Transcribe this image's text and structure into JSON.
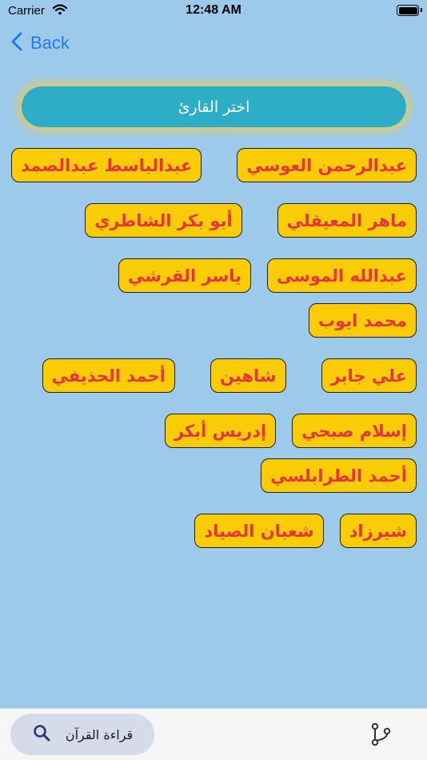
{
  "status_bar": {
    "carrier": "Carrier",
    "time": "12:48 AM"
  },
  "nav": {
    "back_label": "Back",
    "accent_color": "#1d7cf2"
  },
  "title": "اختر القارئ",
  "reciters": [
    "عبدالرحمن العوسي",
    "عبدالباسط عبدالصمد",
    "ماهر المعيقلي",
    "أبو بكر الشاطري",
    "عبدالله الموسى",
    "ياسر القرشي",
    "محمد ايوب",
    "علي جابر",
    "شاهين",
    "أحمد الحذيفي",
    "إسلام صبحي",
    "إدريس أبكر",
    "أحمد الطرابلسي",
    "شيرزاد",
    "شعبان الصياد"
  ],
  "tab_bar": {
    "tabs": [
      {
        "label": "قراءة القرآن",
        "icon": "search-icon",
        "selected": true
      },
      {
        "label": "",
        "icon": "branch-icon",
        "selected": false
      }
    ]
  },
  "colors": {
    "background": "#9dcaea",
    "title_pill": "#2eaec6",
    "button_fill": "#f9cc06",
    "button_text": "#e7343f"
  }
}
